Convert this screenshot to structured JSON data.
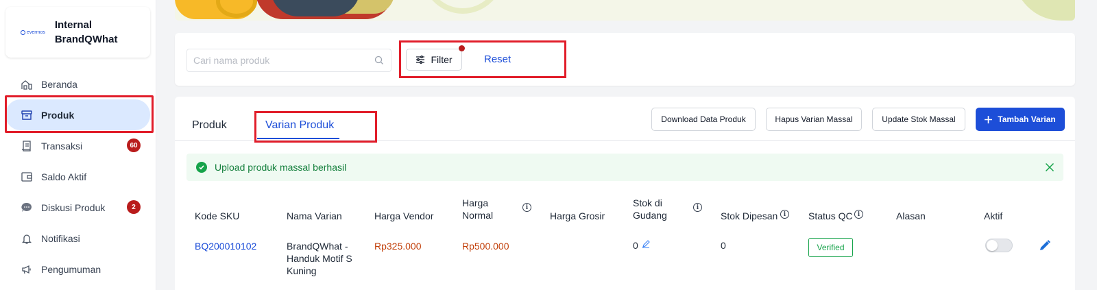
{
  "brand": {
    "logo_text": "evermos",
    "name": "Internal BrandQWhat"
  },
  "sidebar": {
    "items": [
      {
        "label": "Beranda",
        "icon": "home-icon"
      },
      {
        "label": "Produk",
        "icon": "box-icon",
        "active": true
      },
      {
        "label": "Transaksi",
        "icon": "receipt-icon",
        "badge": "60"
      },
      {
        "label": "Saldo Aktif",
        "icon": "wallet-icon"
      },
      {
        "label": "Diskusi Produk",
        "icon": "chat-icon",
        "badge": "2"
      },
      {
        "label": "Notifikasi",
        "icon": "bell-icon"
      },
      {
        "label": "Pengumuman",
        "icon": "megaphone-icon"
      }
    ]
  },
  "search": {
    "placeholder": "Cari nama produk",
    "value": ""
  },
  "filter": {
    "label": "Filter",
    "reset_label": "Reset"
  },
  "tabs": [
    {
      "label": "Produk"
    },
    {
      "label": "Varian Produk",
      "active": true
    }
  ],
  "actions": {
    "download": "Download Data Produk",
    "hapus": "Hapus Varian Massal",
    "update": "Update Stok Massal",
    "add": "Tambah Varian"
  },
  "alert": {
    "text": "Upload produk massal berhasil"
  },
  "table": {
    "headers": {
      "sku": "Kode SKU",
      "nama": "Nama Varian",
      "vendor": "Harga Vendor",
      "normal": "Harga Normal",
      "grosir": "Harga Grosir",
      "gudang": "Stok di Gudang",
      "dipesan": "Stok Dipesan",
      "qc": "Status QC",
      "alasan": "Alasan",
      "aktif": "Aktif"
    },
    "rows": [
      {
        "sku": "BQ200010102",
        "nama": "BrandQWhat - Handuk Motif S Kuning",
        "vendor": "Rp325.000",
        "normal": "Rp500.000",
        "grosir": "",
        "gudang": "0",
        "dipesan": "0",
        "qc": "Verified",
        "alasan": "",
        "aktif": false
      }
    ]
  },
  "colors": {
    "primary": "#1d4ed8",
    "danger": "#b91c1c",
    "success": "#16a34a",
    "price": "#c2410c",
    "highlight": "#e11d2a"
  }
}
